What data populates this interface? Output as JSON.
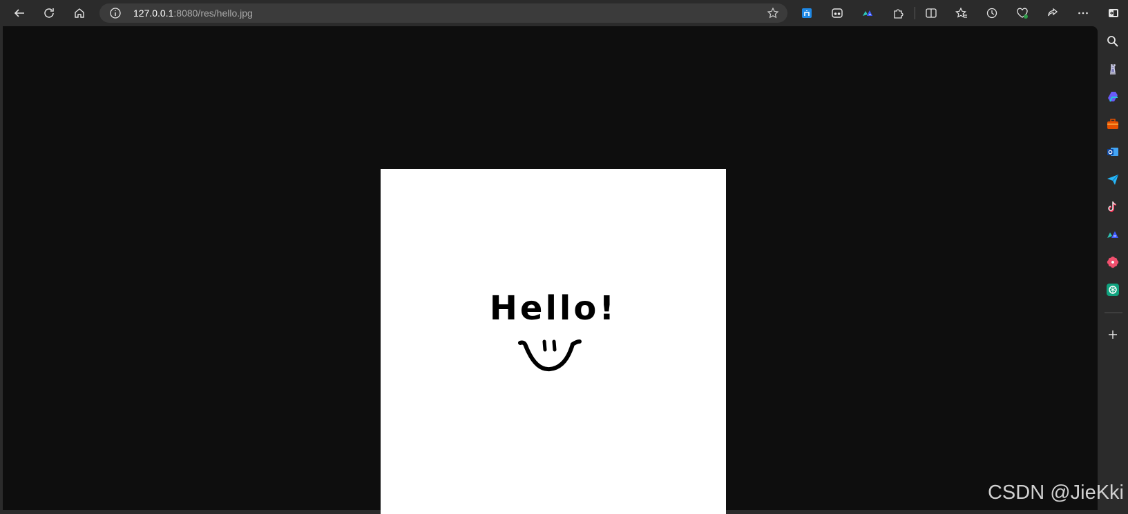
{
  "browser": {
    "address_bar": {
      "url_host": "127.0.0.1",
      "url_rest": ":8080/res/hello.jpg"
    },
    "toolbar_icons": [
      "back-icon",
      "refresh-icon",
      "home-icon",
      "info-icon",
      "favorite-star-icon",
      "extension-blue-icon",
      "extension-mask-icon",
      "extension-translate-icon",
      "extensions-puzzle-icon",
      "split-screen-icon",
      "favorites-icon",
      "history-icon",
      "browser-essentials-icon",
      "share-icon",
      "more-icon",
      "sidebar-toggle-icon"
    ],
    "sidebar_icons": [
      "search-icon",
      "chess-icon",
      "copilot-icon",
      "tools-icon",
      "outlook-icon",
      "send-icon",
      "tiktok-icon",
      "translate-icon",
      "flower-icon",
      "chatgpt-icon",
      "add-icon"
    ]
  },
  "page": {
    "background_color": "#0e0e0e",
    "image": {
      "text": "Hello!"
    }
  },
  "watermark": "CSDN @JieKki"
}
